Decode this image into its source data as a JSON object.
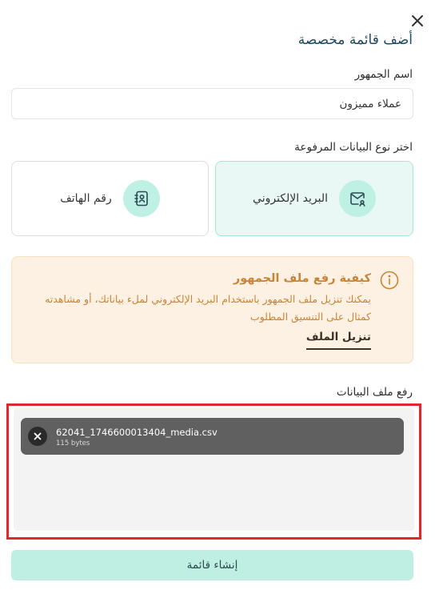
{
  "dialog": {
    "title": "أضف قائمة مخصصة"
  },
  "audience_name": {
    "label": "اسم الجمهور",
    "value": "عملاء مميزون"
  },
  "data_type": {
    "label": "اختر نوع البيانات المرفوعة",
    "options": [
      {
        "label": "البريد الإلكتروني",
        "icon": "mail-user-icon",
        "selected": true
      },
      {
        "label": "رقم الهاتف",
        "icon": "contact-book-icon",
        "selected": false
      }
    ]
  },
  "info": {
    "icon": "info-icon",
    "title": "كيفية رفع ملف الجمهور",
    "text": "يمكنك تنزيل ملف الجمهور باستخدام البريد الإلكتروني لملء بياناتك، أو مشاهدته كمثال على التنسيق المطلوب",
    "download_link": "تنزيل الملف"
  },
  "upload": {
    "label": "رفع ملف البيانات",
    "file": {
      "name": "62041_1746600013404_media.csv",
      "size": "115 bytes"
    }
  },
  "actions": {
    "create_label": "إنشاء قائمة"
  },
  "colors": {
    "accent_light": "#bfeee2",
    "selected_card_bg": "#e9f8f4",
    "info_bg": "#fdf1e3",
    "info_text": "#c98436",
    "highlight": "#e1262d"
  }
}
